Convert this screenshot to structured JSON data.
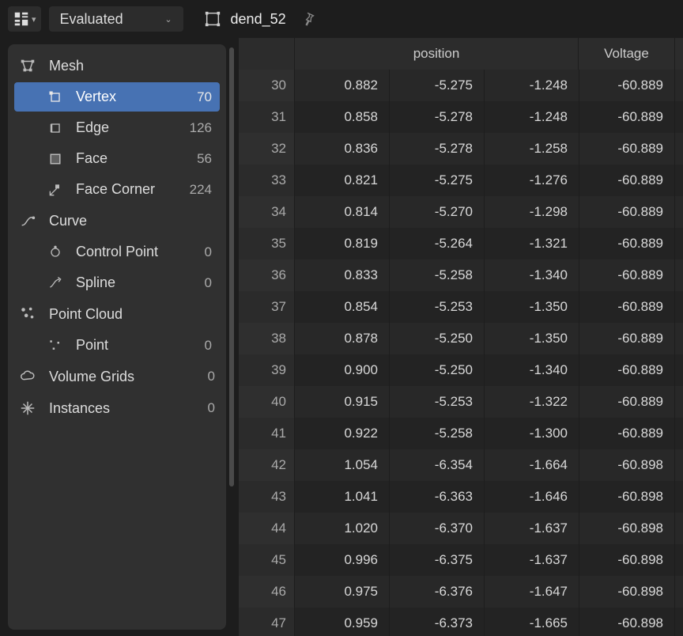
{
  "header": {
    "mode_select": "Evaluated",
    "object_name": "dend_52"
  },
  "sidebar": {
    "groups": [
      {
        "label": "Mesh",
        "icon": "mesh-icon",
        "count": "",
        "items": [
          {
            "label": "Vertex",
            "count": "70",
            "icon": "vertex-icon",
            "active": true
          },
          {
            "label": "Edge",
            "count": "126",
            "icon": "edge-icon",
            "active": false
          },
          {
            "label": "Face",
            "count": "56",
            "icon": "face-icon",
            "active": false
          },
          {
            "label": "Face Corner",
            "count": "224",
            "icon": "face-corner-icon",
            "active": false
          }
        ]
      },
      {
        "label": "Curve",
        "icon": "curve-icon",
        "count": "",
        "items": [
          {
            "label": "Control Point",
            "count": "0",
            "icon": "control-point-icon",
            "active": false
          },
          {
            "label": "Spline",
            "count": "0",
            "icon": "spline-icon",
            "active": false
          }
        ]
      },
      {
        "label": "Point Cloud",
        "icon": "point-cloud-icon",
        "count": "",
        "items": [
          {
            "label": "Point",
            "count": "0",
            "icon": "point-icon",
            "active": false
          }
        ]
      },
      {
        "label": "Volume Grids",
        "icon": "volume-icon",
        "count": "0",
        "items": []
      },
      {
        "label": "Instances",
        "icon": "instances-icon",
        "count": "0",
        "items": []
      }
    ]
  },
  "table": {
    "headers": {
      "position": "position",
      "voltage": "Voltage"
    },
    "rows": [
      {
        "idx": "30",
        "x": "0.882",
        "y": "-5.275",
        "z": "-1.248",
        "v": "-60.889"
      },
      {
        "idx": "31",
        "x": "0.858",
        "y": "-5.278",
        "z": "-1.248",
        "v": "-60.889"
      },
      {
        "idx": "32",
        "x": "0.836",
        "y": "-5.278",
        "z": "-1.258",
        "v": "-60.889"
      },
      {
        "idx": "33",
        "x": "0.821",
        "y": "-5.275",
        "z": "-1.276",
        "v": "-60.889"
      },
      {
        "idx": "34",
        "x": "0.814",
        "y": "-5.270",
        "z": "-1.298",
        "v": "-60.889"
      },
      {
        "idx": "35",
        "x": "0.819",
        "y": "-5.264",
        "z": "-1.321",
        "v": "-60.889"
      },
      {
        "idx": "36",
        "x": "0.833",
        "y": "-5.258",
        "z": "-1.340",
        "v": "-60.889"
      },
      {
        "idx": "37",
        "x": "0.854",
        "y": "-5.253",
        "z": "-1.350",
        "v": "-60.889"
      },
      {
        "idx": "38",
        "x": "0.878",
        "y": "-5.250",
        "z": "-1.350",
        "v": "-60.889"
      },
      {
        "idx": "39",
        "x": "0.900",
        "y": "-5.250",
        "z": "-1.340",
        "v": "-60.889"
      },
      {
        "idx": "40",
        "x": "0.915",
        "y": "-5.253",
        "z": "-1.322",
        "v": "-60.889"
      },
      {
        "idx": "41",
        "x": "0.922",
        "y": "-5.258",
        "z": "-1.300",
        "v": "-60.889"
      },
      {
        "idx": "42",
        "x": "1.054",
        "y": "-6.354",
        "z": "-1.664",
        "v": "-60.898"
      },
      {
        "idx": "43",
        "x": "1.041",
        "y": "-6.363",
        "z": "-1.646",
        "v": "-60.898"
      },
      {
        "idx": "44",
        "x": "1.020",
        "y": "-6.370",
        "z": "-1.637",
        "v": "-60.898"
      },
      {
        "idx": "45",
        "x": "0.996",
        "y": "-6.375",
        "z": "-1.637",
        "v": "-60.898"
      },
      {
        "idx": "46",
        "x": "0.975",
        "y": "-6.376",
        "z": "-1.647",
        "v": "-60.898"
      },
      {
        "idx": "47",
        "x": "0.959",
        "y": "-6.373",
        "z": "-1.665",
        "v": "-60.898"
      }
    ]
  }
}
